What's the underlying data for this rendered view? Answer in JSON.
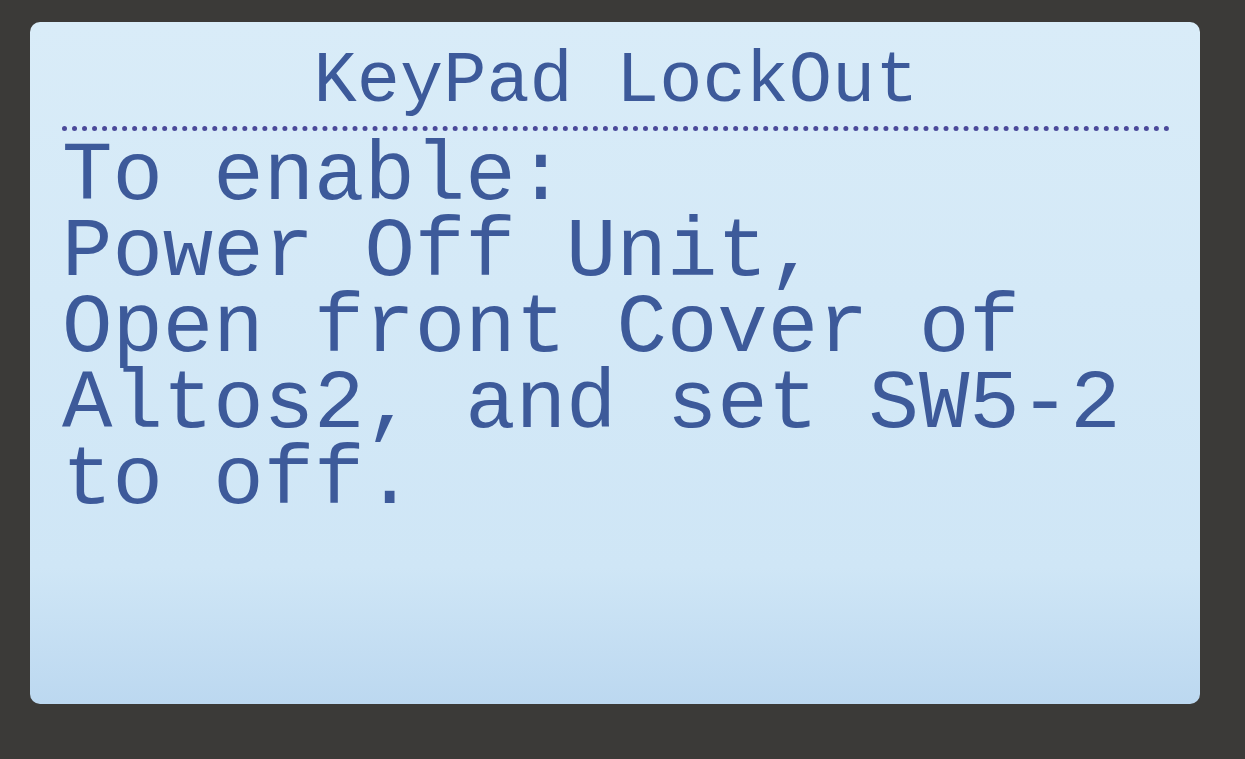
{
  "screen": {
    "title": "KeyPad LockOut",
    "lines": [
      "To enable:",
      "Power Off Unit,",
      "Open front Cover of",
      "Altos2, and set SW5-2",
      "to off."
    ]
  }
}
